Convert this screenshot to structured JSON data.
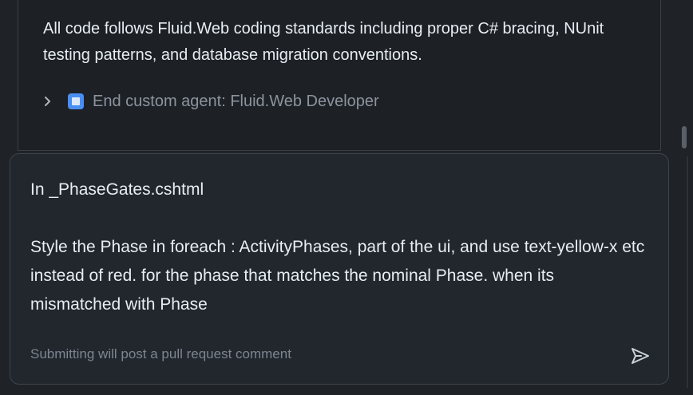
{
  "agent": {
    "message": "All code follows Fluid.Web coding standards including proper C# bracing, NUnit\ntesting patterns, and database migration conventions.",
    "end_label": "End custom agent: Fluid.Web Developer",
    "accent_color": "#4a8ef0"
  },
  "composer": {
    "line1": "In _PhaseGates.cshtml",
    "line2": "Style the Phase in foreach : ActivityPhases, part of the ui, and use text-yellow-x etc instead of red. for the phase that matches the nominal Phase. when its mismatched with Phase",
    "footer": "Submitting will post a pull request comment"
  },
  "icons": {
    "expand": "chevron-right-icon",
    "agent": "agent-square-icon",
    "send": "send-icon"
  }
}
